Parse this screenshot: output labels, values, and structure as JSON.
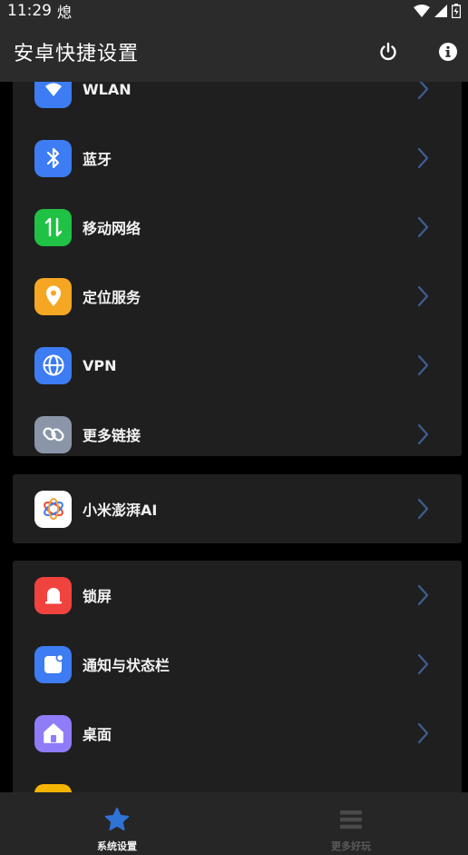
{
  "status_bar": {
    "time": "11:29",
    "extra": "熄"
  },
  "app_bar": {
    "title": "安卓快捷设置",
    "power_icon": "power-icon",
    "info_icon": "info-icon"
  },
  "sections": [
    {
      "items": [
        {
          "label": "WLAN",
          "icon": "wifi-icon",
          "color": "#3d7cf2"
        },
        {
          "label": "蓝牙",
          "icon": "bluetooth-icon",
          "color": "#3d7cf2"
        },
        {
          "label": "移动网络",
          "icon": "mobile-data-icon",
          "color": "#1fc244"
        },
        {
          "label": "定位服务",
          "icon": "location-pin-icon",
          "color": "#f5a623"
        },
        {
          "label": "VPN",
          "icon": "globe-icon",
          "color": "#3d7cf2"
        },
        {
          "label": "更多链接",
          "icon": "link-icon",
          "color": "#8a96a8"
        }
      ]
    },
    {
      "items": [
        {
          "label": "小米澎湃AI",
          "icon": "hyper-ai-icon",
          "color": "#ffffff"
        }
      ]
    },
    {
      "items": [
        {
          "label": "锁屏",
          "icon": "lock-screen-icon",
          "color": "#f1433e"
        },
        {
          "label": "通知与状态栏",
          "icon": "notification-icon",
          "color": "#3d7cf2"
        },
        {
          "label": "桌面",
          "icon": "home-icon",
          "color": "#8f7cf8"
        },
        {
          "label": "",
          "icon": "sun-icon",
          "color": "#f5b400"
        }
      ]
    }
  ],
  "bottom_nav": {
    "tabs": [
      {
        "label": "系统设置",
        "icon": "star-icon",
        "active": true,
        "color": "#2f73d4"
      },
      {
        "label": "更多好玩",
        "icon": "list-icon",
        "active": false,
        "color": "#4a4a4a"
      }
    ]
  }
}
